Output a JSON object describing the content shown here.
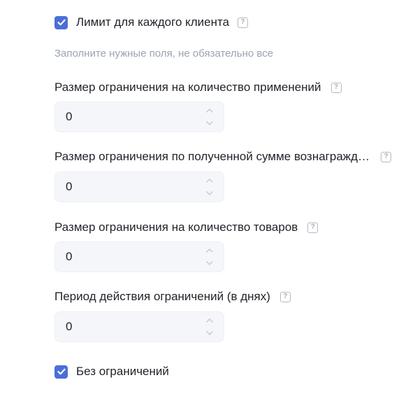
{
  "limit_per_client": {
    "label": "Лимит для каждого клиента",
    "checked": true,
    "help": "?"
  },
  "hint": "Заполните нужные поля, не обязательно все",
  "fields": [
    {
      "label": "Размер ограничения на количество применений",
      "value": "0",
      "help": "?"
    },
    {
      "label": "Размер ограничения по полученной сумме вознагражд…",
      "value": "0",
      "help": "?"
    },
    {
      "label": "Размер ограничения на количество товаров",
      "value": "0",
      "help": "?"
    },
    {
      "label": "Период действия ограничений (в днях)",
      "value": "0",
      "help": "?"
    }
  ],
  "no_limits": {
    "label": "Без ограничений",
    "checked": true
  },
  "colors": {
    "accent": "#4a6fd6",
    "input_bg": "#f5f6fa",
    "hint_text": "#9aa3b2"
  },
  "icons": {
    "checkbox": "checkmark-icon",
    "help": "question-mark-icon",
    "spin_up": "chevron-up-icon",
    "spin_down": "chevron-down-icon"
  }
}
